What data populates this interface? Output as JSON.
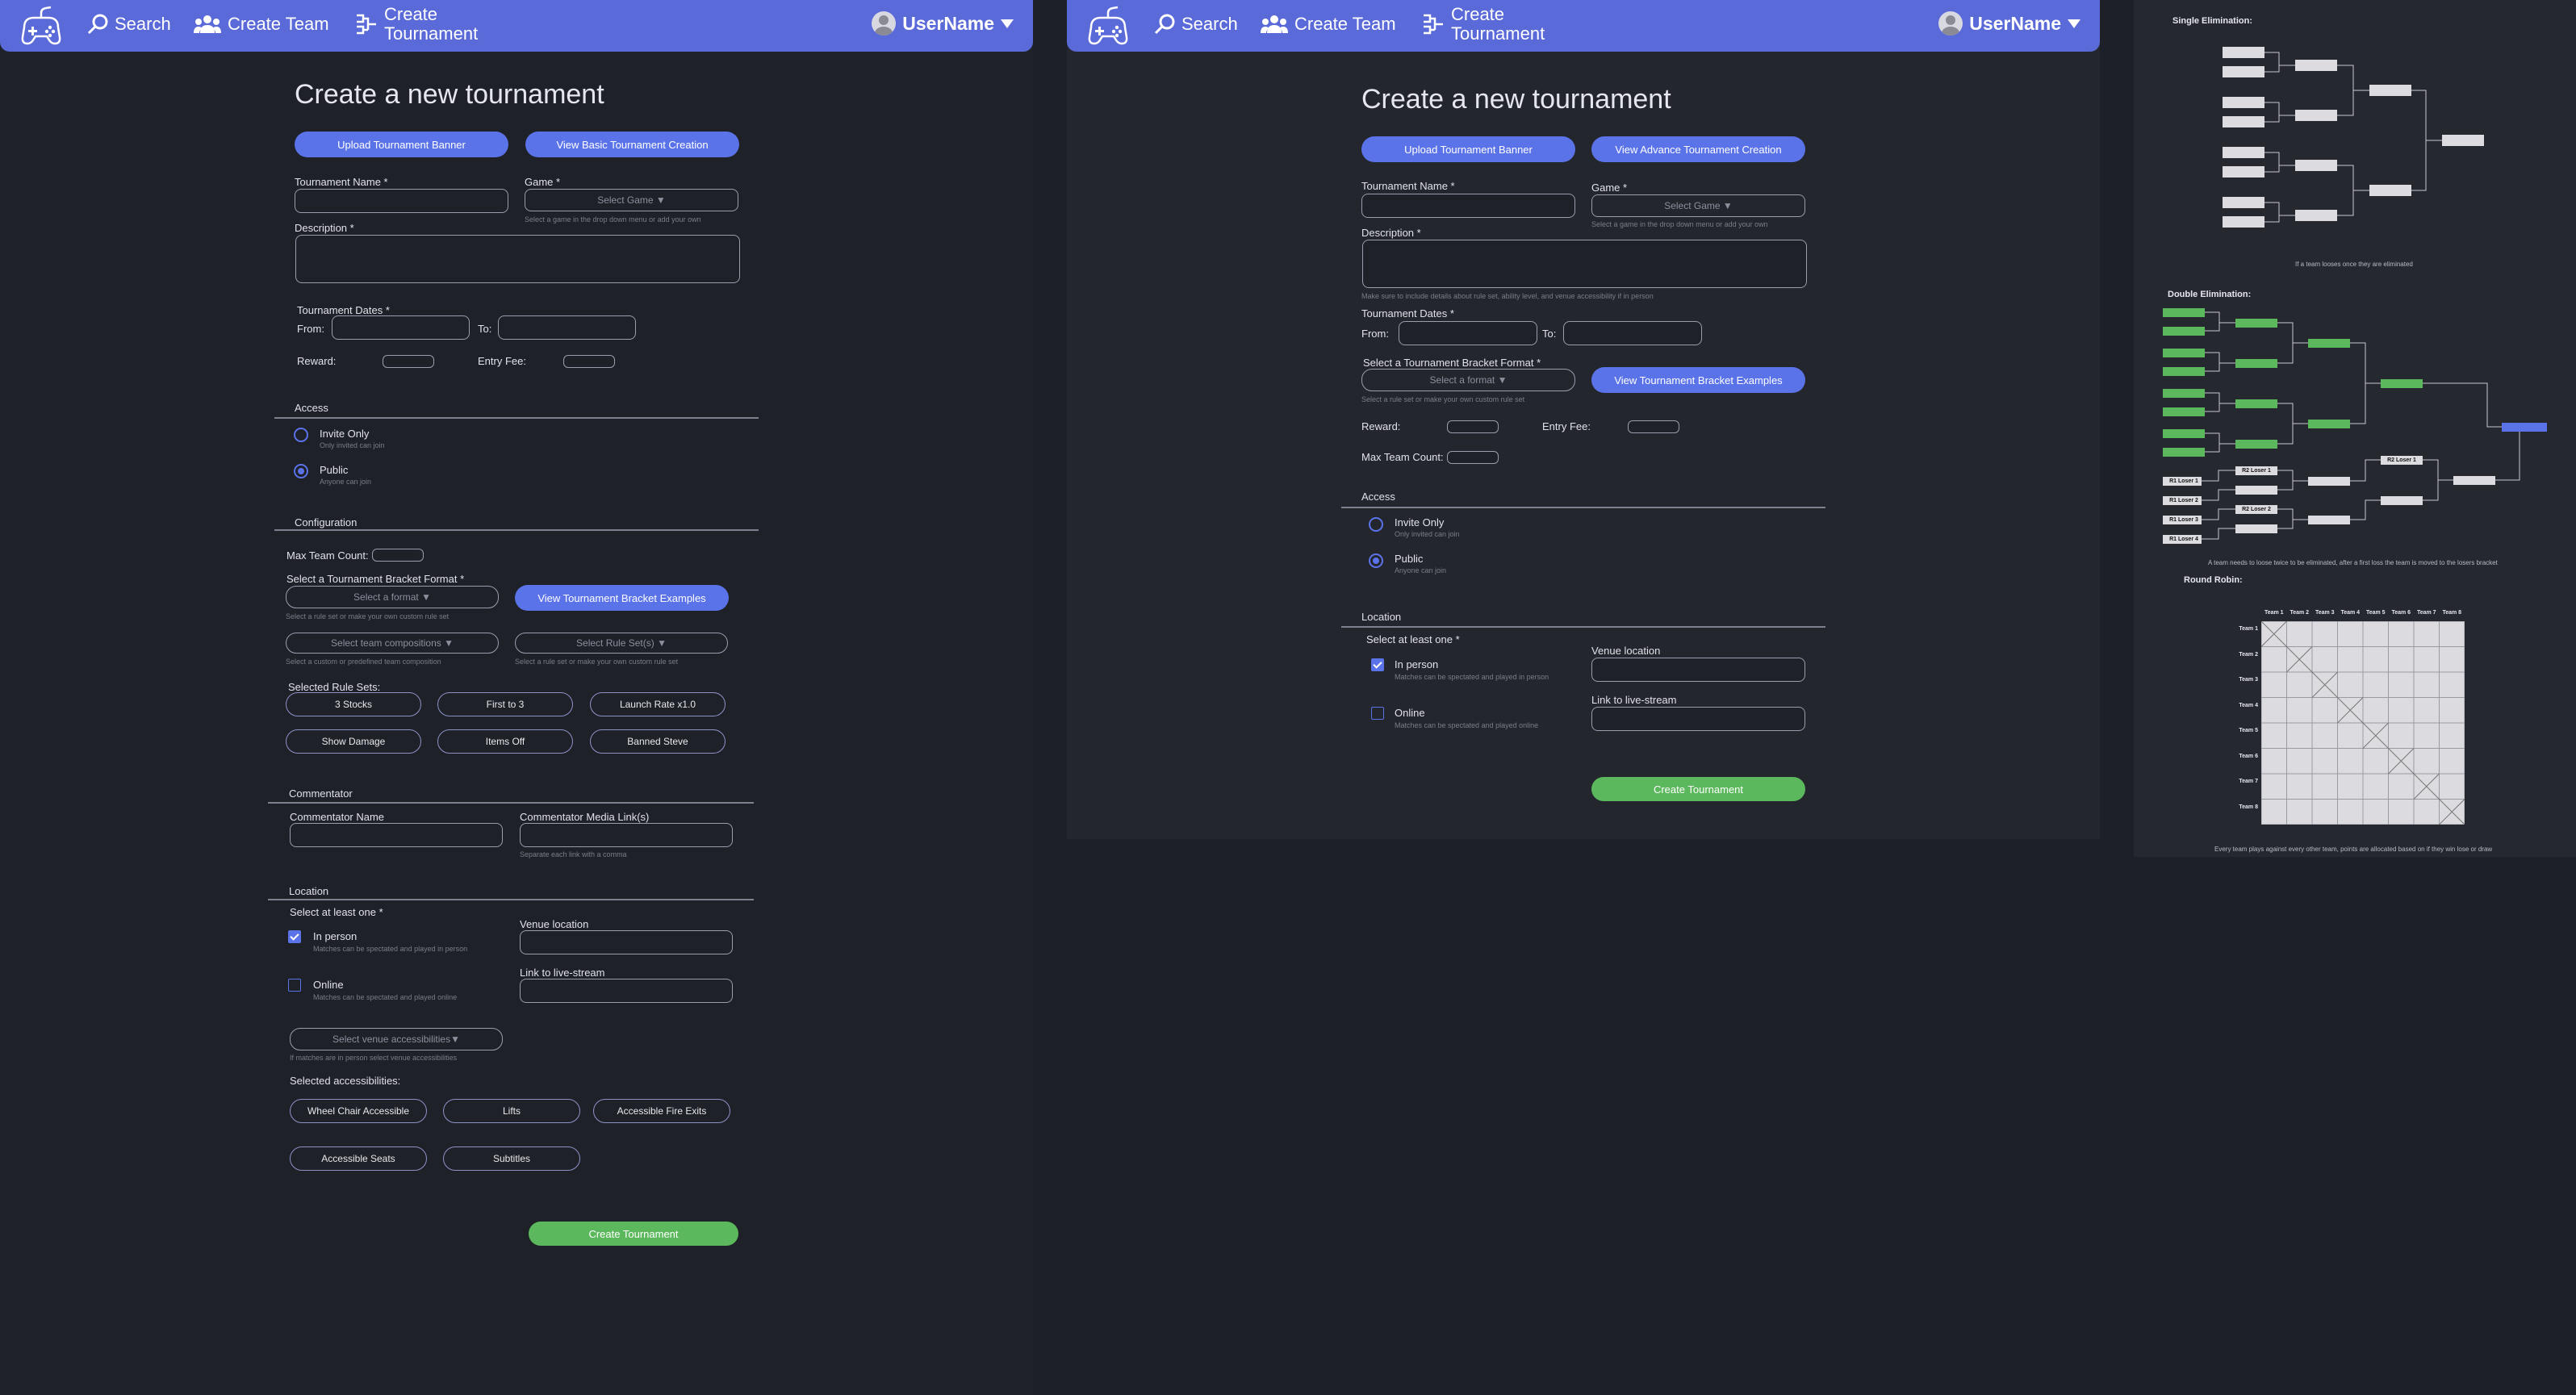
{
  "nav": {
    "search": "Search",
    "create_team": "Create Team",
    "create_tournament_line1": "Create",
    "create_tournament_line2": "Tournament",
    "username": "UserName"
  },
  "advanced": {
    "title": "Create a new tournament",
    "upload_banner": "Upload Tournament Banner",
    "toggle_view": "View Basic Tournament Creation",
    "tournament_name_label": "Tournament Name *",
    "game_label": "Game *",
    "game_select": "Select Game",
    "game_hint": "Select a game in the drop down menu or add your own",
    "description_label": "Description *",
    "dates_label": "Tournament Dates *",
    "from_label": "From:",
    "to_label": "To:",
    "reward_label": "Reward:",
    "entry_fee_label": "Entry Fee:",
    "access_heading": "Access",
    "invite_only": "Invite Only",
    "invite_only_hint": "Only invited can join",
    "public": "Public",
    "public_hint": "Anyone can join",
    "config_heading": "Configuration",
    "max_team_label": "Max Team Count:",
    "bracket_label": "Select a Tournament Bracket Format *",
    "bracket_select": "Select a format",
    "bracket_hint": "Select a rule set or make your own custom rule set",
    "bracket_examples": "View Tournament Bracket Examples",
    "team_comp_select": "Select team compositions",
    "team_comp_hint": "Select a custom or predefined team composition",
    "rule_set_select": "Select Rule Set(s)",
    "rule_set_hint": "Select a rule set or make your own custom rule set",
    "selected_rules_label": "Selected Rule Sets:",
    "rule_sets": [
      "3 Stocks",
      "First to 3",
      "Launch Rate x1.0",
      "Show Damage",
      "Items Off",
      "Banned Steve"
    ],
    "commentator_heading": "Commentator",
    "commentator_name_label": "Commentator Name",
    "commentator_links_label": "Commentator Media Link(s)",
    "commentator_links_hint": "Separate each link with a comma",
    "location_heading": "Location",
    "select_one_label": "Select at least one *",
    "in_person": "In person",
    "in_person_hint": "Matches can be spectated and played in person",
    "online": "Online",
    "online_hint": "Matches can be spectated and played online",
    "venue_label": "Venue location",
    "livestream_label": "Link to live-stream",
    "accessibility_select": "Select venue accessibilities",
    "accessibility_hint": "If matches are in person select venue accessibilities",
    "selected_access_label": "Selected accessibilities:",
    "accessibilities": [
      "Wheel Chair Accessible",
      "Lifts",
      "Accessible Fire Exits",
      "Accessible Seats",
      "Subtitles"
    ],
    "submit": "Create Tournament"
  },
  "basic": {
    "title": "Create a new tournament",
    "upload_banner": "Upload Tournament Banner",
    "toggle_view": "View Advance Tournament Creation",
    "tournament_name_label": "Tournament Name *",
    "game_label": "Game *",
    "game_select": "Select Game",
    "game_hint": "Select a game in the drop down menu or add your own",
    "description_label": "Description *",
    "description_hint": "Make sure to include details about rule set, ability level, and venue accessibility if in person",
    "dates_label": "Tournament Dates *",
    "from_label": "From:",
    "to_label": "To:",
    "bracket_label": "Select a Tournament Bracket Format *",
    "bracket_select": "Select a format",
    "bracket_hint": "Select a rule set or make your own custom rule set",
    "bracket_examples": "View Tournament Bracket Examples",
    "reward_label": "Reward:",
    "entry_fee_label": "Entry Fee:",
    "max_team_label": "Max Team Count:",
    "access_heading": "Access",
    "invite_only": "Invite Only",
    "invite_only_hint": "Only invited can join",
    "public": "Public",
    "public_hint": "Anyone can join",
    "location_heading": "Location",
    "select_one_label": "Select at least one *",
    "in_person": "In person",
    "in_person_hint": "Matches can be spectated and played in person",
    "online": "Online",
    "online_hint": "Matches can be spectated and played online",
    "venue_label": "Venue location",
    "livestream_label": "Link to live-stream",
    "submit": "Create Tournament"
  },
  "examples": {
    "single_label": "Single Elimination:",
    "single_note": "If a team looses once they are eliminated",
    "double_label": "Double Elimination:",
    "double_note": "A team needs to loose twice to be eliminated, after a first loss the team is moved to the losers bracket",
    "losers": [
      "R1 Loser 1",
      "R1 Loser 2",
      "R1 Loser 3",
      "R1 Loser 4",
      "R2 Loser 1",
      "R2 Loser 2",
      "R2 Loser 1"
    ],
    "round_robin_label": "Round Robin:",
    "round_robin_note": "Every team plays against every other team, points are allocated based on if they win lose or draw",
    "teams": [
      "Team 1",
      "Team 2",
      "Team 3",
      "Team 4",
      "Team 5",
      "Team 6",
      "Team 7",
      "Team 8"
    ]
  },
  "colors": {
    "navbar": "#5a6ad8",
    "accent": "#5b73e8",
    "success": "#5cb85c",
    "background": "#1f2129"
  },
  "icons": [
    "gamepad-icon",
    "search-icon",
    "team-icon",
    "bracket-icon",
    "user-avatar-icon",
    "chevron-down-icon"
  ]
}
